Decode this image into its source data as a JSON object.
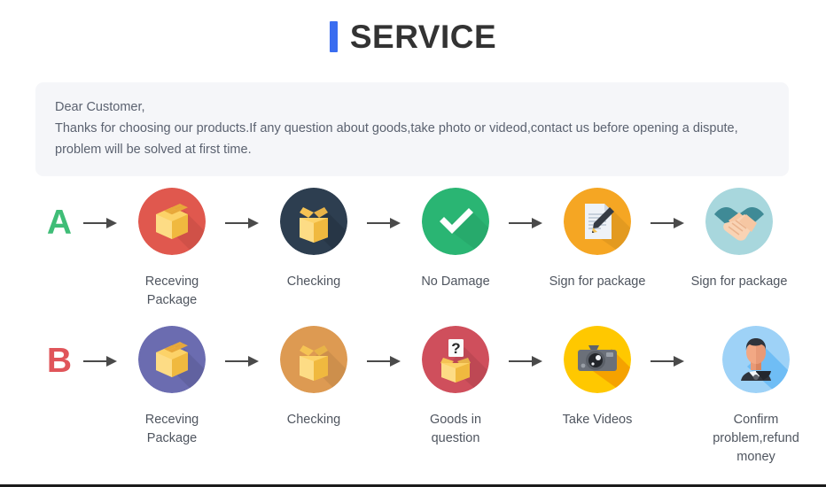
{
  "page": {
    "title": "SERVICE",
    "accent_color": "#3a6df0",
    "background": "#ffffff"
  },
  "notice": {
    "greeting": "Dear Customer,",
    "line1": "Thanks for choosing our products.If any question about goods,take photo or videod,contact us before opening a dispute,",
    "line2": "problem will be solved at first time.",
    "background": "#f5f6f9",
    "text_color": "#5b6270"
  },
  "flows": [
    {
      "letter": "A",
      "letter_color": "#3fbd77",
      "steps": [
        {
          "label": "Receving Package",
          "icon": "closed-box-icon",
          "circle_color": "#e0584e"
        },
        {
          "label": "Checking",
          "icon": "open-box-icon",
          "circle_color": "#2d3e50"
        },
        {
          "label": "No Damage",
          "icon": "check-mark-icon",
          "circle_color": "#2ab573"
        },
        {
          "label": "Sign for package",
          "icon": "document-pen-icon",
          "circle_color": "#f5a623"
        },
        {
          "label": "Sign for package",
          "icon": "handshake-icon",
          "circle_color": "#a8d7dd"
        }
      ]
    },
    {
      "letter": "B",
      "letter_color": "#e0555a",
      "steps": [
        {
          "label": "Receving Package",
          "icon": "closed-box-icon",
          "circle_color": "#6b6cb0"
        },
        {
          "label": "Checking",
          "icon": "open-box-icon",
          "circle_color": "#dd9a52"
        },
        {
          "label": "Goods in question",
          "icon": "question-box-icon",
          "circle_color": "#cf4f5c"
        },
        {
          "label": "Take Videos",
          "icon": "camera-icon",
          "circle_color": "#ffc800"
        },
        {
          "label": "Confirm problem,refund\nmoney",
          "icon": "person-avatar-icon",
          "circle_color": "#9ed2f7"
        }
      ]
    }
  ],
  "arrow": {
    "name": "arrow-right-icon",
    "color": "#4a4a4a"
  }
}
